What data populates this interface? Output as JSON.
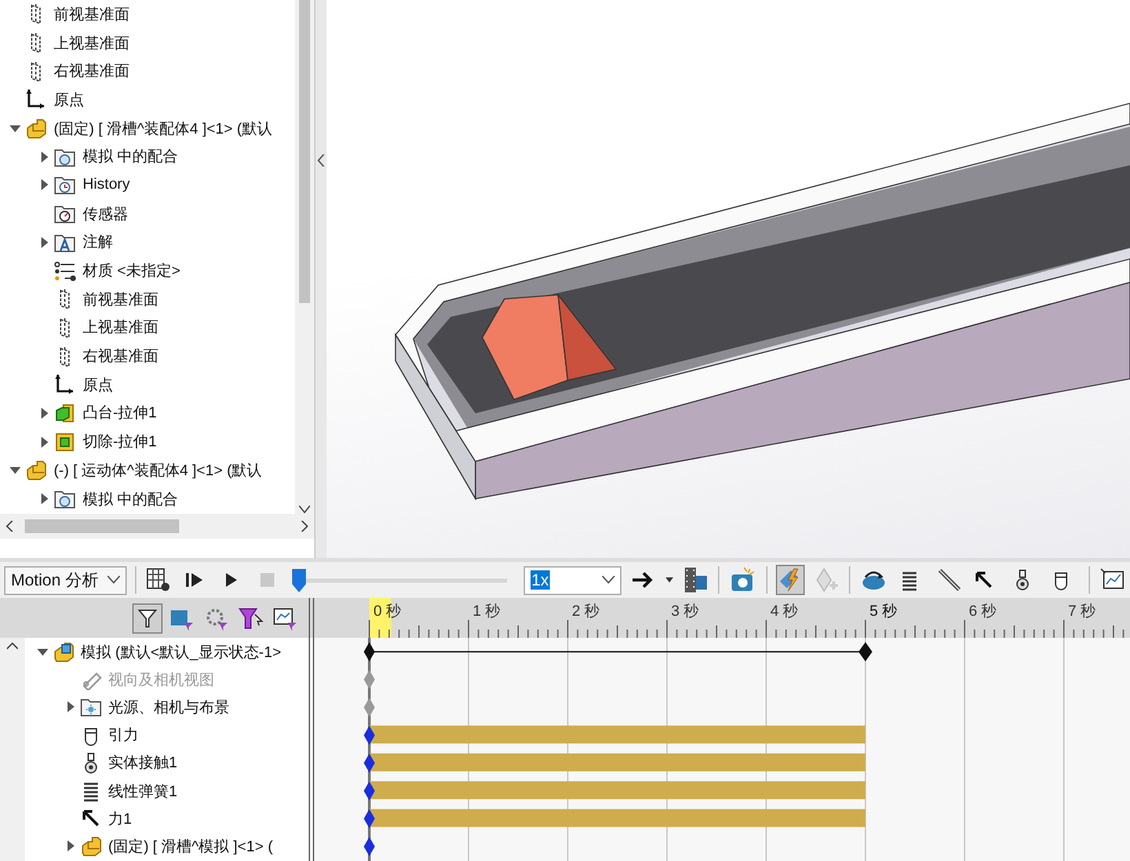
{
  "feature_tree": [
    {
      "label": "前视基准面",
      "kind": "plane"
    },
    {
      "label": "上视基准面",
      "kind": "plane"
    },
    {
      "label": "右视基准面",
      "kind": "plane"
    },
    {
      "label": "原点",
      "kind": "origin"
    },
    {
      "label": "(固定) [ 滑槽^装配体4 ]<1> (默认",
      "kind": "assembly",
      "expanded": true,
      "children": [
        {
          "label": "模拟 中的配合",
          "kind": "mates",
          "expanded": false
        },
        {
          "label": "History",
          "kind": "history",
          "expanded": false
        },
        {
          "label": "传感器",
          "kind": "sensor"
        },
        {
          "label": "注解",
          "kind": "annotation",
          "expanded": false
        },
        {
          "label": "材质 <未指定>",
          "kind": "material"
        },
        {
          "label": "前视基准面",
          "kind": "plane"
        },
        {
          "label": "上视基准面",
          "kind": "plane"
        },
        {
          "label": "右视基准面",
          "kind": "plane"
        },
        {
          "label": "原点",
          "kind": "origin"
        },
        {
          "label": "凸台-拉伸1",
          "kind": "boss",
          "expanded": false
        },
        {
          "label": "切除-拉伸1",
          "kind": "cut",
          "expanded": false
        }
      ]
    },
    {
      "label": "(-) [ 运动体^装配体4 ]<1> (默认",
      "kind": "assembly",
      "expanded": true,
      "children": [
        {
          "label": "模拟 中的配合",
          "kind": "mates",
          "expanded": false
        }
      ]
    }
  ],
  "toolbar": {
    "study_type": "Motion 分析",
    "playback": {
      "level": 0
    },
    "speed": "1x",
    "autokey_on": true
  },
  "timeline": {
    "filter_on": true,
    "ticks": [
      {
        "label": "0 秒",
        "current": true,
        "end": false
      },
      {
        "label": "1 秒",
        "current": false,
        "end": false
      },
      {
        "label": "2 秒",
        "current": false,
        "end": false
      },
      {
        "label": "3 秒",
        "current": false,
        "end": false
      },
      {
        "label": "4 秒",
        "current": false,
        "end": false
      },
      {
        "label": "5 秒",
        "current": false,
        "end": true
      },
      {
        "label": "6 秒",
        "current": false,
        "end": false
      },
      {
        "label": "7 秒",
        "current": false,
        "end": false
      }
    ],
    "tree": [
      {
        "label": "模拟  (默认<默认_显示状态-1>",
        "kind": "study",
        "expanded": true,
        "disabled": false,
        "track": {
          "kind": "span"
        },
        "children": [
          {
            "label": "视向及相机视图",
            "kind": "camera",
            "disabled": true,
            "track": {
              "kind": "key_gray"
            }
          },
          {
            "label": "光源、相机与布景",
            "kind": "lights",
            "expanded": false,
            "disabled": false,
            "track": {
              "kind": "key_gray"
            }
          },
          {
            "label": "引力",
            "kind": "gravity",
            "disabled": false,
            "track": {
              "kind": "bar"
            }
          },
          {
            "label": "实体接触1",
            "kind": "contact",
            "disabled": false,
            "track": {
              "kind": "bar"
            }
          },
          {
            "label": "线性弹簧1",
            "kind": "spring",
            "disabled": false,
            "track": {
              "kind": "bar"
            }
          },
          {
            "label": "力1",
            "kind": "force",
            "disabled": false,
            "track": {
              "kind": "bar"
            }
          },
          {
            "label": "(固定) [ 滑槽^模拟 ]<1> (",
            "kind": "assembly",
            "expanded": false,
            "disabled": false,
            "track": {
              "kind": "key"
            }
          }
        ]
      }
    ]
  }
}
